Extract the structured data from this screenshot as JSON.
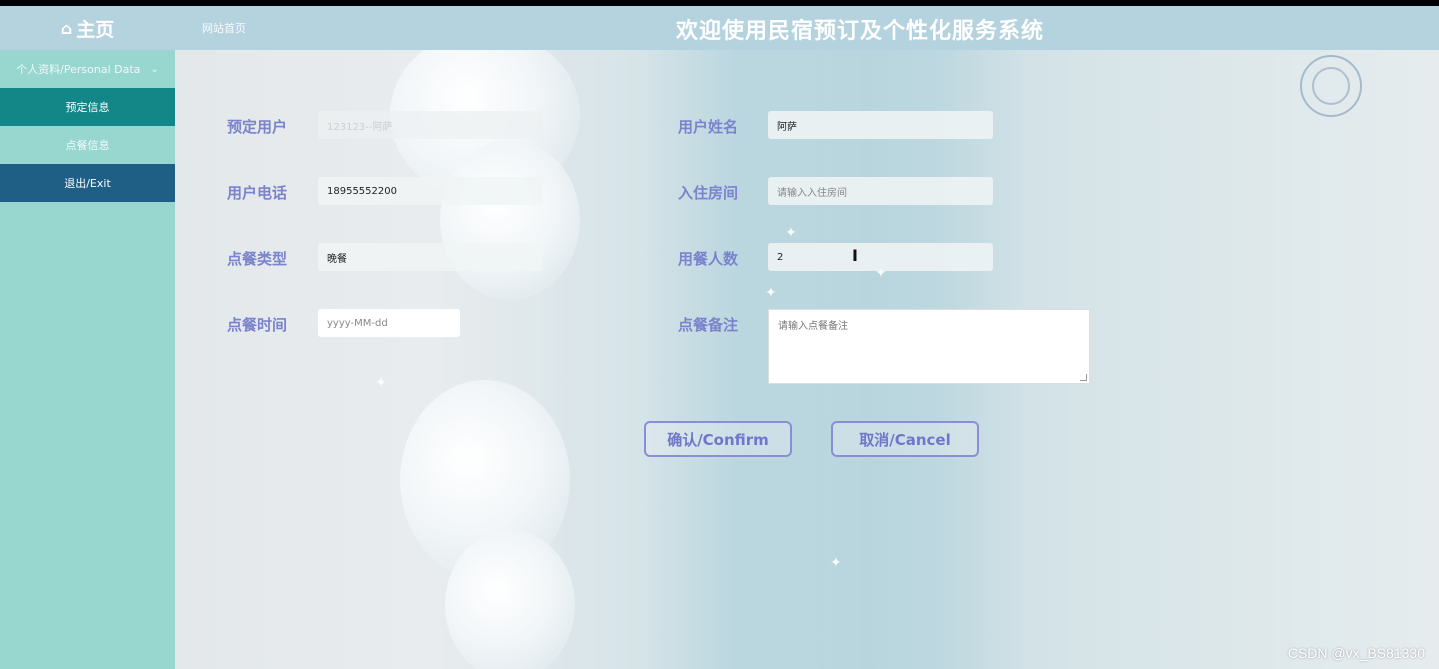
{
  "header": {
    "home_icon": "home-icon",
    "home_label": "主页",
    "site_link": "网站首页",
    "title": "欢迎使用民宿预订及个性化服务系统"
  },
  "sidebar": {
    "group_label": "个人资料/Personal Data",
    "group_chevron": "chevron-down-icon",
    "items": [
      {
        "label": "预定信息",
        "state": "active"
      },
      {
        "label": "点餐信息",
        "state": "normal"
      },
      {
        "label": "退出/Exit",
        "state": "exit"
      }
    ]
  },
  "form": {
    "booking_user": {
      "label": "预定用户",
      "value": "123123--阿萨"
    },
    "user_name": {
      "label": "用户姓名",
      "value": "阿萨"
    },
    "user_phone": {
      "label": "用户电话",
      "value": "18955552200"
    },
    "room": {
      "label": "入住房间",
      "placeholder": "请输入入住房间"
    },
    "meal_type": {
      "label": "点餐类型",
      "value": "晚餐"
    },
    "diners": {
      "label": "用餐人数",
      "value": "2"
    },
    "meal_time": {
      "label": "点餐时间",
      "placeholder": "yyyy-MM-dd"
    },
    "meal_note": {
      "label": "点餐备注",
      "placeholder": "请输入点餐备注"
    }
  },
  "buttons": {
    "confirm": "确认/Confirm",
    "cancel": "取消/Cancel"
  },
  "watermark": "CSDN @vx_BS81330",
  "colors": {
    "header_bg": "#b4d3df",
    "sidebar_bg": "#98d6d0",
    "active_item": "#138688",
    "exit_item": "#1f5f85",
    "label_color": "#7b83cc"
  }
}
